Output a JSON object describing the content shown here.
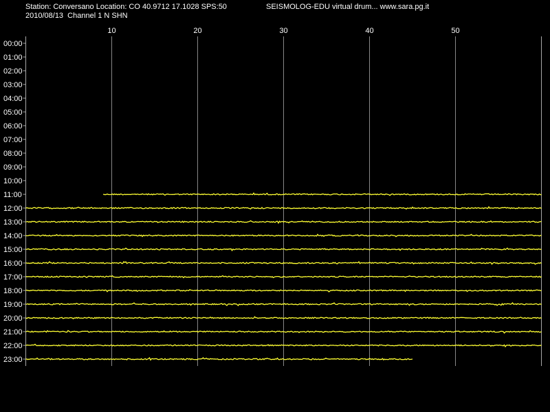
{
  "header": {
    "station_line": "Station: Conversano Location: CO 40.9712 17.1028 SPS:50",
    "date_channel_line": "2010/08/13  Channel 1 N SHN",
    "app_line": "SEISMOLOG-EDU virtual drum... www.sara.pg.it"
  },
  "colors": {
    "background": "#000000",
    "text": "#ffffff",
    "trace": "#ffff33",
    "grid": "#888888",
    "frame": "#aaaaaa"
  },
  "chart_data": {
    "type": "line",
    "x_unit": "minutes",
    "xlim": [
      0,
      60
    ],
    "x_ticks": [
      10,
      20,
      30,
      40,
      50
    ],
    "hours": [
      "00:00",
      "01:00",
      "02:00",
      "03:00",
      "04:00",
      "05:00",
      "06:00",
      "07:00",
      "08:00",
      "09:00",
      "10:00",
      "11:00",
      "12:00",
      "13:00",
      "14:00",
      "15:00",
      "16:00",
      "17:00",
      "18:00",
      "19:00",
      "20:00",
      "21:00",
      "22:00",
      "23:00"
    ],
    "traces": [
      {
        "hour": "11:00",
        "start_min": 9,
        "end_min": 60
      },
      {
        "hour": "12:00",
        "start_min": 0,
        "end_min": 60
      },
      {
        "hour": "13:00",
        "start_min": 0,
        "end_min": 60
      },
      {
        "hour": "14:00",
        "start_min": 0,
        "end_min": 60
      },
      {
        "hour": "15:00",
        "start_min": 0,
        "end_min": 60
      },
      {
        "hour": "16:00",
        "start_min": 0,
        "end_min": 60
      },
      {
        "hour": "17:00",
        "start_min": 0,
        "end_min": 60
      },
      {
        "hour": "18:00",
        "start_min": 0,
        "end_min": 60
      },
      {
        "hour": "19:00",
        "start_min": 0,
        "end_min": 60
      },
      {
        "hour": "20:00",
        "start_min": 0,
        "end_min": 60
      },
      {
        "hour": "21:00",
        "start_min": 0,
        "end_min": 60
      },
      {
        "hour": "22:00",
        "start_min": 0,
        "end_min": 60
      },
      {
        "hour": "23:00",
        "start_min": 0,
        "end_min": 45
      }
    ],
    "grid": true
  }
}
